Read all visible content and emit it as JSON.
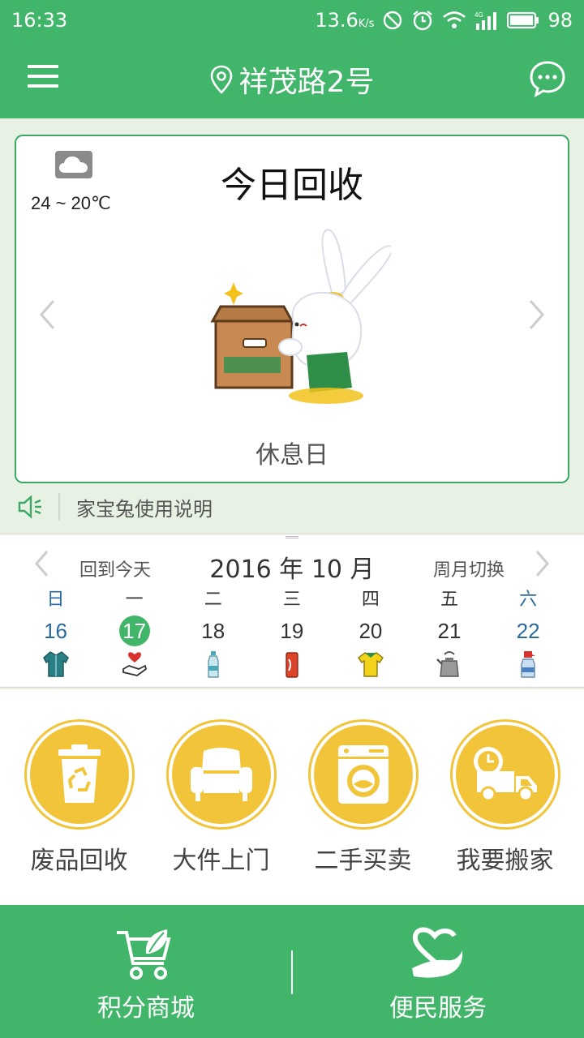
{
  "status_bar": {
    "time": "16:33",
    "speed": "13.6",
    "speed_unit": "K/s",
    "battery": "98",
    "network": "4G"
  },
  "app_bar": {
    "location": "祥茂路2号",
    "icons": [
      "menu-icon",
      "location-pin-icon",
      "chat-icon"
    ]
  },
  "today": {
    "title": "今日回收",
    "weather_icon": "cloud-icon",
    "temperature": "24 ~ 20℃",
    "status": "休息日"
  },
  "guide": {
    "text": "家宝兔使用说明"
  },
  "calendar": {
    "back_today": "回到今天",
    "month": "2016 年 10 月",
    "switch": "周月切换",
    "days": [
      {
        "weekday": "日",
        "date": "16",
        "item": "clothes-icon",
        "weekend": true
      },
      {
        "weekday": "一",
        "date": "17",
        "item": "heart-hand-icon",
        "today": true
      },
      {
        "weekday": "二",
        "date": "18",
        "item": "bottle-icon"
      },
      {
        "weekday": "三",
        "date": "19",
        "item": "can-icon"
      },
      {
        "weekday": "四",
        "date": "20",
        "item": "shirt-icon"
      },
      {
        "weekday": "五",
        "date": "21",
        "item": "kettle-icon"
      },
      {
        "weekday": "六",
        "date": "22",
        "item": "spray-bottle-icon",
        "weekend": true
      }
    ]
  },
  "services": [
    {
      "label": "废品回收",
      "icon": "recycle-bin-icon"
    },
    {
      "label": "大件上门",
      "icon": "sofa-icon"
    },
    {
      "label": "二手买卖",
      "icon": "washing-machine-icon"
    },
    {
      "label": "我要搬家",
      "icon": "moving-truck-icon"
    }
  ],
  "bottom_nav": [
    {
      "label": "积分商城",
      "icon": "shopping-cart-icon"
    },
    {
      "label": "便民服务",
      "icon": "heart-hand-icon"
    }
  ],
  "colors": {
    "primary": "#41b66b",
    "accent": "#f2c43a",
    "weekend": "#2a6aa0"
  }
}
